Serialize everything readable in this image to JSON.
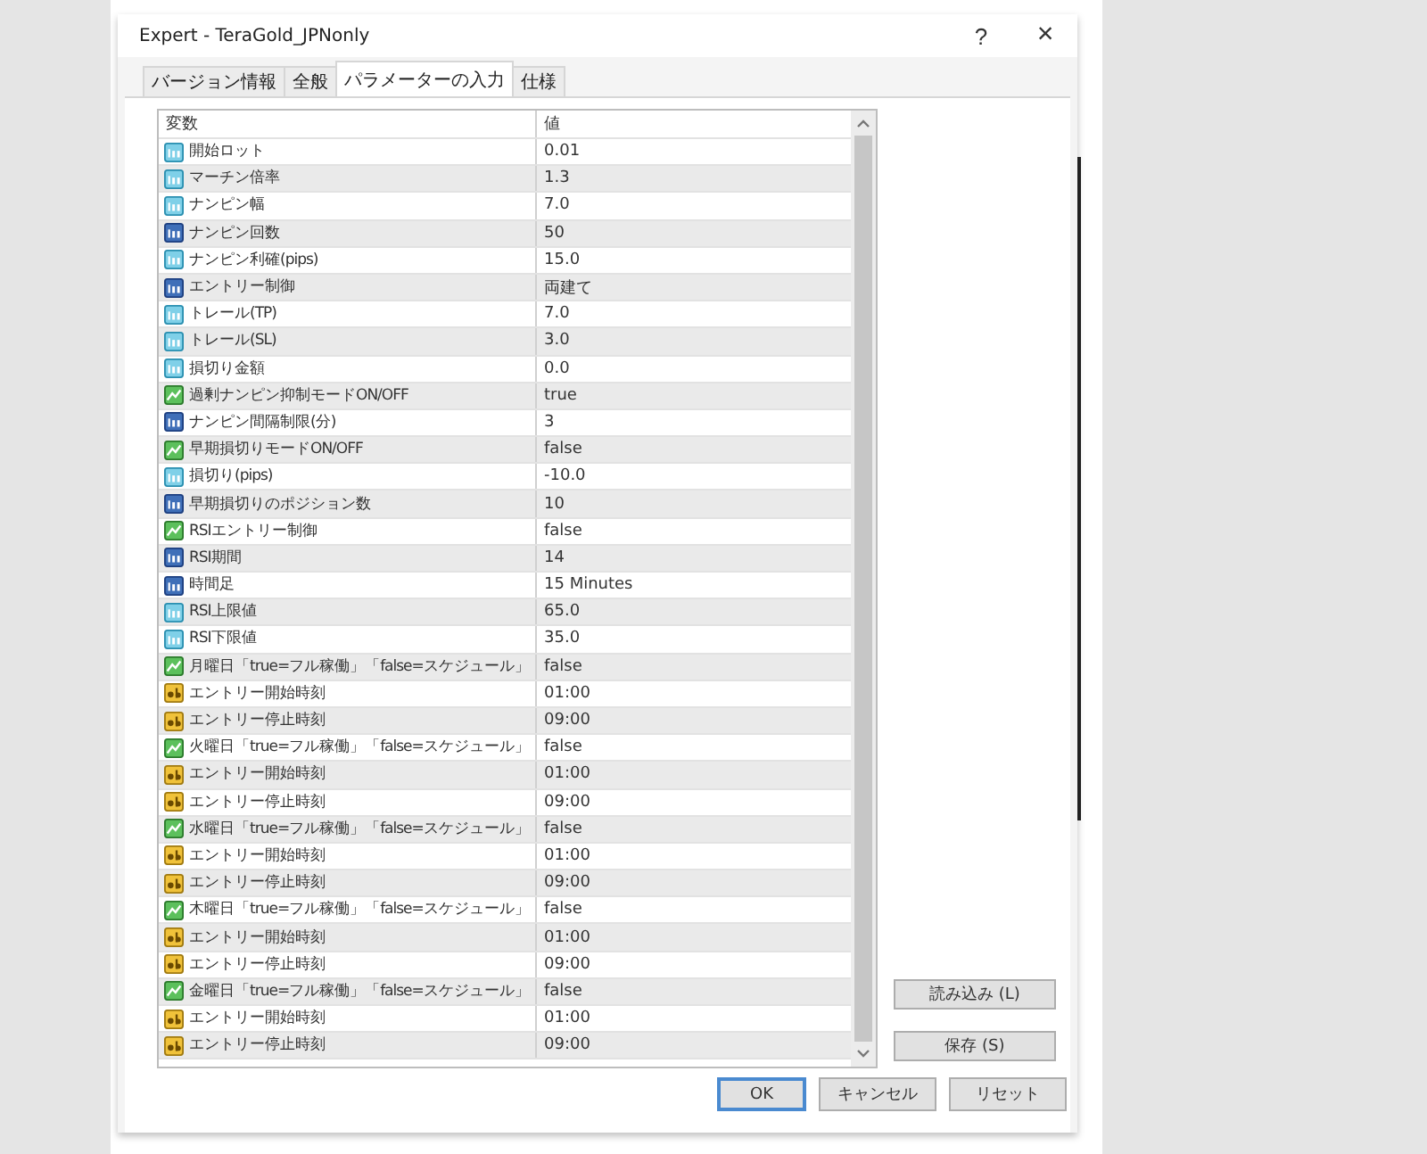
{
  "window": {
    "title": "Expert - TeraGold_JPNonly",
    "help": "?",
    "close": "×"
  },
  "tabs": [
    {
      "label": "バージョン情報",
      "selected": false
    },
    {
      "label": "全般",
      "selected": false
    },
    {
      "label": "パラメーターの入力",
      "selected": true
    },
    {
      "label": "仕様",
      "selected": false
    }
  ],
  "table": {
    "columns": [
      "変数",
      "値"
    ],
    "rows": [
      {
        "kind": "double",
        "name": "開始ロット",
        "value": "0.01"
      },
      {
        "kind": "double",
        "name": "マーチン倍率",
        "value": "1.3"
      },
      {
        "kind": "double",
        "name": "ナンピン幅",
        "value": "7.0"
      },
      {
        "kind": "int",
        "name": "ナンピン回数",
        "value": "50"
      },
      {
        "kind": "double",
        "name": "ナンピン利確(pips)",
        "value": "15.0"
      },
      {
        "kind": "int",
        "name": "エントリー制御",
        "value": "両建て"
      },
      {
        "kind": "double",
        "name": "トレール(TP)",
        "value": "7.0"
      },
      {
        "kind": "double",
        "name": "トレール(SL)",
        "value": "3.0"
      },
      {
        "kind": "double",
        "name": "損切り金額",
        "value": "0.0"
      },
      {
        "kind": "bool",
        "name": "過剰ナンピン抑制モードON/OFF",
        "value": "true"
      },
      {
        "kind": "int",
        "name": "ナンピン間隔制限(分)",
        "value": "3"
      },
      {
        "kind": "bool",
        "name": "早期損切りモードON/OFF",
        "value": "false"
      },
      {
        "kind": "double",
        "name": "損切り(pips)",
        "value": "-10.0"
      },
      {
        "kind": "int",
        "name": "早期損切りのポジション数",
        "value": "10"
      },
      {
        "kind": "bool",
        "name": "RSIエントリー制御",
        "value": "false"
      },
      {
        "kind": "int",
        "name": "RSI期間",
        "value": "14"
      },
      {
        "kind": "int",
        "name": "時間足",
        "value": "15 Minutes"
      },
      {
        "kind": "double",
        "name": "RSI上限値",
        "value": "65.0"
      },
      {
        "kind": "double",
        "name": "RSI下限値",
        "value": "35.0"
      },
      {
        "kind": "bool",
        "name": "月曜日「true=フル稼働」「false=スケジュール」",
        "value": "false"
      },
      {
        "kind": "string",
        "name": "エントリー開始時刻",
        "value": "01:00"
      },
      {
        "kind": "string",
        "name": "エントリー停止時刻",
        "value": "09:00"
      },
      {
        "kind": "bool",
        "name": "火曜日「true=フル稼働」「false=スケジュール」",
        "value": "false"
      },
      {
        "kind": "string",
        "name": "エントリー開始時刻",
        "value": "01:00"
      },
      {
        "kind": "string",
        "name": "エントリー停止時刻",
        "value": "09:00"
      },
      {
        "kind": "bool",
        "name": "水曜日「true=フル稼働」「false=スケジュール」",
        "value": "false"
      },
      {
        "kind": "string",
        "name": "エントリー開始時刻",
        "value": "01:00"
      },
      {
        "kind": "string",
        "name": "エントリー停止時刻",
        "value": "09:00"
      },
      {
        "kind": "bool",
        "name": "木曜日「true=フル稼働」「false=スケジュール」",
        "value": "false"
      },
      {
        "kind": "string",
        "name": "エントリー開始時刻",
        "value": "01:00"
      },
      {
        "kind": "string",
        "name": "エントリー停止時刻",
        "value": "09:00"
      },
      {
        "kind": "bool",
        "name": "金曜日「true=フル稼働」「false=スケジュール」",
        "value": "false"
      },
      {
        "kind": "string",
        "name": "エントリー開始時刻",
        "value": "01:00"
      },
      {
        "kind": "string",
        "name": "エントリー停止時刻",
        "value": "09:00"
      }
    ]
  },
  "side_buttons": [
    "読み込み (L)",
    "保存 (S)"
  ],
  "buttons": [
    {
      "label": "OK",
      "default": true
    },
    {
      "label": "キャンセル",
      "default": false
    },
    {
      "label": "リセット",
      "default": false
    }
  ]
}
